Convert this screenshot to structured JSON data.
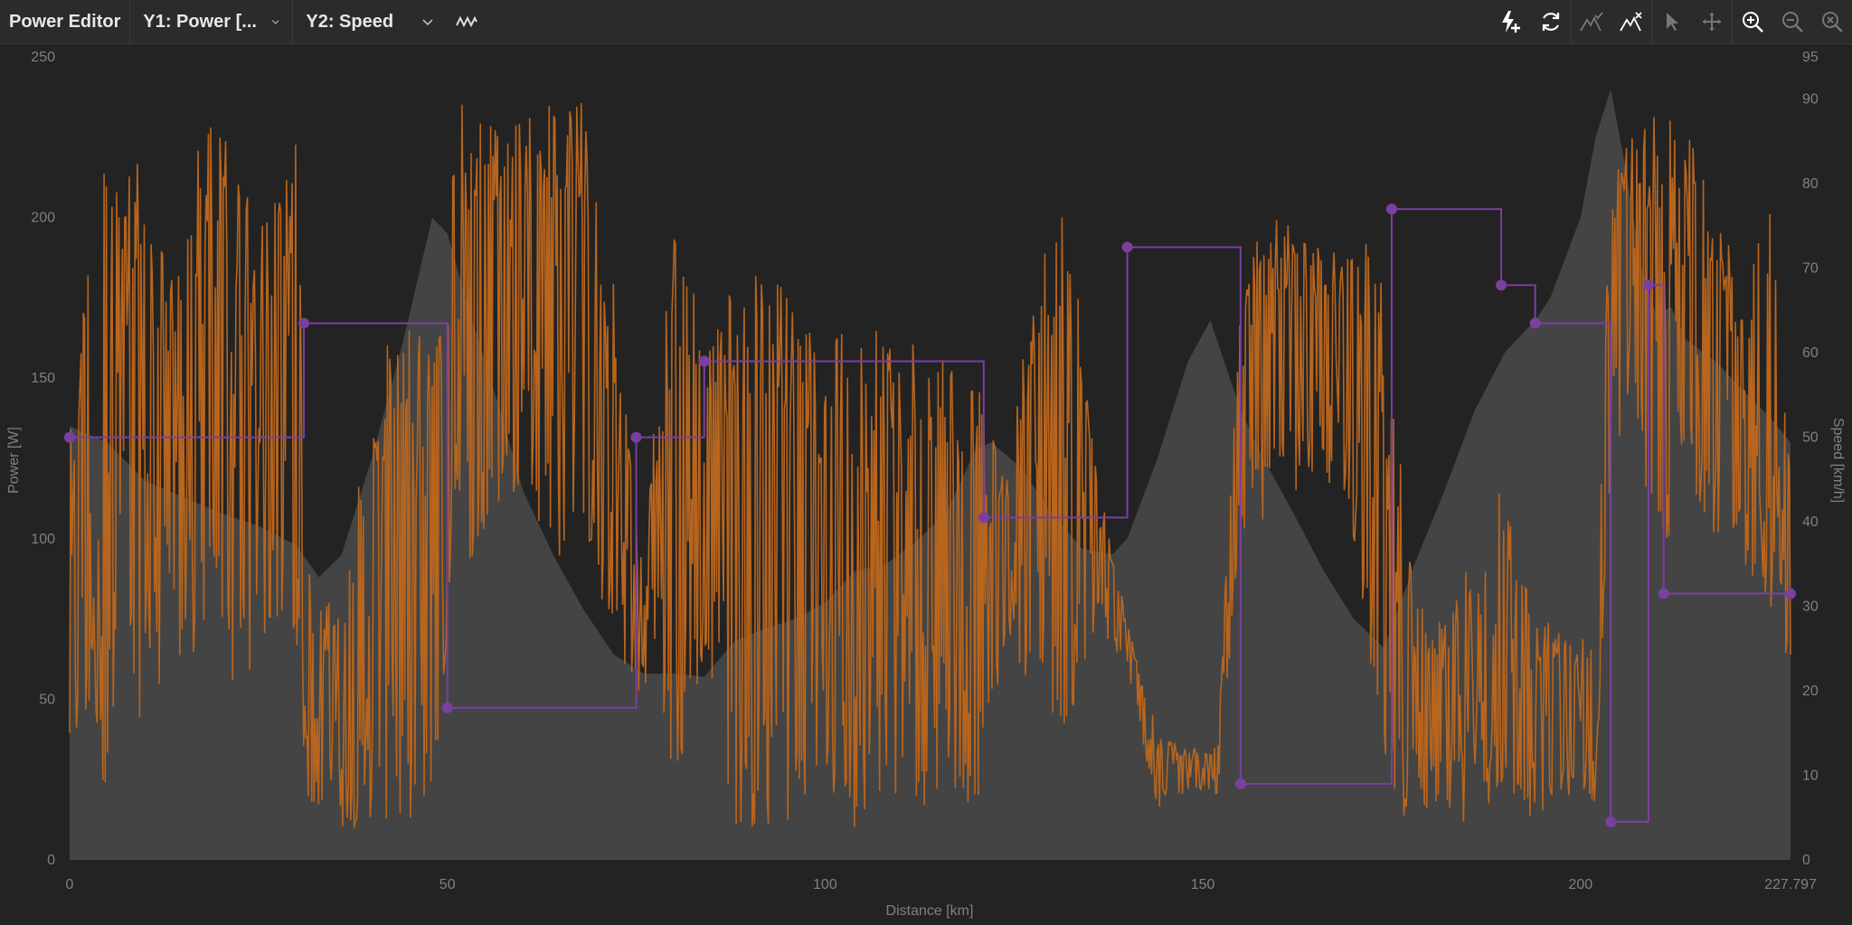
{
  "toolbar": {
    "title": "Power Editor",
    "y1_select": "Y1: Power [...",
    "y2_select": "Y2: Speed",
    "icons": [
      "waveform-icon",
      "lightning-add-icon",
      "refresh-icon",
      "mountain-check-icon",
      "mountain-remove-icon",
      "pointer-icon",
      "move-icon",
      "zoom-in-icon",
      "zoom-out-icon",
      "zoom-reset-icon"
    ]
  },
  "chart_data": {
    "type": "line",
    "xlabel": "Distance [km]",
    "ylabel_left": "Power [W]",
    "ylabel_right": "Speed [km/h]",
    "x_range": [
      0,
      227.797
    ],
    "y1_range": [
      0,
      250
    ],
    "y2_range": [
      0,
      95
    ],
    "x_ticks": [
      "0",
      "50",
      "100",
      "150",
      "200",
      "227.797"
    ],
    "y1_ticks": [
      "0",
      "50",
      "100",
      "150",
      "200",
      "250"
    ],
    "y2_ticks": [
      "0",
      "10",
      "20",
      "30",
      "40",
      "50",
      "60",
      "70",
      "80",
      "90",
      "95"
    ],
    "colors": {
      "power": "#b8651e",
      "speed": "#7b3fa0",
      "elevation": "#444444",
      "background": "#232323"
    },
    "elevation": {
      "x": [
        0,
        5,
        10,
        15,
        20,
        25,
        30,
        33,
        36,
        40,
        44,
        48,
        50,
        53,
        57,
        60,
        64,
        68,
        72,
        76,
        80,
        84,
        88,
        92,
        96,
        100,
        104,
        108,
        112,
        116,
        120,
        122,
        126,
        130,
        134,
        138,
        140,
        144,
        148,
        151,
        155,
        158,
        162,
        166,
        170,
        174,
        178,
        182,
        186,
        190,
        194,
        196,
        200,
        202,
        204,
        206,
        208,
        210,
        212,
        214,
        218,
        222,
        225,
        227.797
      ],
      "y": [
        135,
        130,
        118,
        113,
        108,
        104,
        98,
        88,
        95,
        125,
        160,
        200,
        195,
        170,
        140,
        115,
        95,
        78,
        64,
        58,
        58,
        57,
        68,
        72,
        75,
        80,
        90,
        92,
        99,
        108,
        128,
        130,
        122,
        108,
        97,
        95,
        100,
        125,
        155,
        168,
        140,
        125,
        108,
        90,
        75,
        66,
        92,
        115,
        140,
        158,
        168,
        175,
        200,
        225,
        240,
        215,
        185,
        170,
        172,
        162,
        155,
        145,
        138,
        130
      ]
    },
    "speed_points": [
      {
        "x": 0,
        "y": 50
      },
      {
        "x": 31,
        "y": 50
      },
      {
        "x": 31,
        "y": 63.5
      },
      {
        "x": 50,
        "y": 63.5
      },
      {
        "x": 50,
        "y": 18
      },
      {
        "x": 75,
        "y": 18
      },
      {
        "x": 75,
        "y": 50
      },
      {
        "x": 84,
        "y": 50
      },
      {
        "x": 84,
        "y": 59
      },
      {
        "x": 121,
        "y": 59
      },
      {
        "x": 121,
        "y": 40.5
      },
      {
        "x": 140,
        "y": 40.5
      },
      {
        "x": 140,
        "y": 72.5
      },
      {
        "x": 155,
        "y": 72.5
      },
      {
        "x": 155,
        "y": 9
      },
      {
        "x": 175,
        "y": 9
      },
      {
        "x": 175,
        "y": 77
      },
      {
        "x": 189.5,
        "y": 77
      },
      {
        "x": 189.5,
        "y": 68
      },
      {
        "x": 194,
        "y": 68
      },
      {
        "x": 194,
        "y": 63.5
      },
      {
        "x": 204,
        "y": 63.5
      },
      {
        "x": 204,
        "y": 4.5
      },
      {
        "x": 209,
        "y": 4.5
      },
      {
        "x": 209,
        "y": 68
      },
      {
        "x": 211,
        "y": 68
      },
      {
        "x": 211,
        "y": 31.5
      },
      {
        "x": 227.797,
        "y": 31.5
      }
    ],
    "speed_markers": [
      {
        "x": 0,
        "y": 50
      },
      {
        "x": 31,
        "y": 63.5
      },
      {
        "x": 50,
        "y": 18
      },
      {
        "x": 75,
        "y": 50
      },
      {
        "x": 84,
        "y": 59
      },
      {
        "x": 121,
        "y": 40.5
      },
      {
        "x": 140,
        "y": 72.5
      },
      {
        "x": 155,
        "y": 9
      },
      {
        "x": 175,
        "y": 77
      },
      {
        "x": 189.5,
        "y": 68
      },
      {
        "x": 194,
        "y": 63.5
      },
      {
        "x": 204,
        "y": 4.5
      },
      {
        "x": 209,
        "y": 68
      },
      {
        "x": 211,
        "y": 31.5
      },
      {
        "x": 227.797,
        "y": 31.5
      }
    ],
    "power_envelope": [
      {
        "x": 0,
        "a": 130,
        "b": 0
      },
      {
        "x": 2,
        "a": 190,
        "b": 30
      },
      {
        "x": 6,
        "a": 237,
        "b": 20
      },
      {
        "x": 10,
        "a": 210,
        "b": 50
      },
      {
        "x": 14,
        "a": 180,
        "b": 60
      },
      {
        "x": 18,
        "a": 236,
        "b": 60
      },
      {
        "x": 22,
        "a": 220,
        "b": 50
      },
      {
        "x": 26,
        "a": 200,
        "b": 70
      },
      {
        "x": 30,
        "a": 225,
        "b": 55
      },
      {
        "x": 32,
        "a": 80,
        "b": 10
      },
      {
        "x": 36,
        "a": 80,
        "b": 10
      },
      {
        "x": 40,
        "a": 150,
        "b": 10
      },
      {
        "x": 44,
        "a": 170,
        "b": 10
      },
      {
        "x": 48,
        "a": 170,
        "b": 15
      },
      {
        "x": 52,
        "a": 237,
        "b": 90
      },
      {
        "x": 56,
        "a": 237,
        "b": 100
      },
      {
        "x": 60,
        "a": 230,
        "b": 120
      },
      {
        "x": 64,
        "a": 237,
        "b": 90
      },
      {
        "x": 68,
        "a": 237,
        "b": 100
      },
      {
        "x": 72,
        "a": 180,
        "b": 60
      },
      {
        "x": 76,
        "a": 100,
        "b": 50
      },
      {
        "x": 80,
        "a": 200,
        "b": 10
      },
      {
        "x": 84,
        "a": 170,
        "b": 60
      },
      {
        "x": 88,
        "a": 180,
        "b": 10
      },
      {
        "x": 92,
        "a": 190,
        "b": 10
      },
      {
        "x": 96,
        "a": 170,
        "b": 10
      },
      {
        "x": 100,
        "a": 160,
        "b": 20
      },
      {
        "x": 104,
        "a": 180,
        "b": 10
      },
      {
        "x": 108,
        "a": 170,
        "b": 20
      },
      {
        "x": 112,
        "a": 160,
        "b": 15
      },
      {
        "x": 116,
        "a": 155,
        "b": 20
      },
      {
        "x": 120,
        "a": 150,
        "b": 15
      },
      {
        "x": 124,
        "a": 120,
        "b": 70
      },
      {
        "x": 128,
        "a": 185,
        "b": 50
      },
      {
        "x": 132,
        "a": 215,
        "b": 40
      },
      {
        "x": 136,
        "a": 120,
        "b": 70
      },
      {
        "x": 140,
        "a": 75,
        "b": 60
      },
      {
        "x": 144,
        "a": 40,
        "b": 15
      },
      {
        "x": 148,
        "a": 35,
        "b": 20
      },
      {
        "x": 152,
        "a": 35,
        "b": 20
      },
      {
        "x": 155,
        "a": 190,
        "b": 100
      },
      {
        "x": 160,
        "a": 200,
        "b": 110
      },
      {
        "x": 165,
        "a": 190,
        "b": 120
      },
      {
        "x": 170,
        "a": 200,
        "b": 100
      },
      {
        "x": 174,
        "a": 180,
        "b": 20
      },
      {
        "x": 178,
        "a": 80,
        "b": 10
      },
      {
        "x": 182,
        "a": 80,
        "b": 15
      },
      {
        "x": 186,
        "a": 100,
        "b": 10
      },
      {
        "x": 190,
        "a": 120,
        "b": 20
      },
      {
        "x": 194,
        "a": 80,
        "b": 10
      },
      {
        "x": 198,
        "a": 70,
        "b": 20
      },
      {
        "x": 202,
        "a": 80,
        "b": 15
      },
      {
        "x": 204,
        "a": 220,
        "b": 120
      },
      {
        "x": 207,
        "a": 230,
        "b": 150
      },
      {
        "x": 210,
        "a": 237,
        "b": 80
      },
      {
        "x": 214,
        "a": 230,
        "b": 120
      },
      {
        "x": 218,
        "a": 200,
        "b": 100
      },
      {
        "x": 222,
        "a": 180,
        "b": 90
      },
      {
        "x": 225,
        "a": 210,
        "b": 80
      },
      {
        "x": 227.797,
        "a": 120,
        "b": 60
      }
    ]
  }
}
